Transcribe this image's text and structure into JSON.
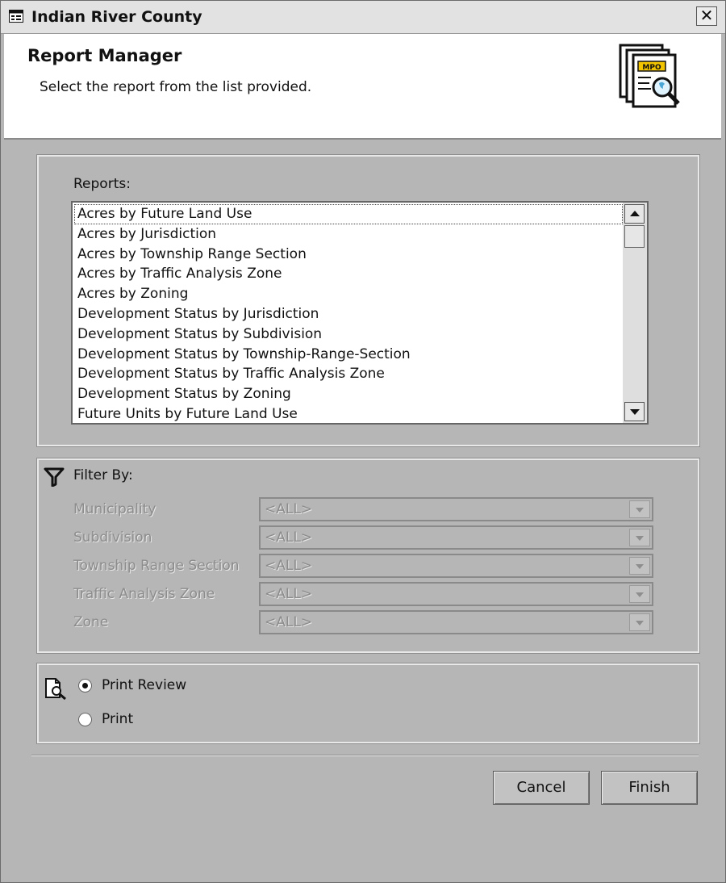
{
  "window": {
    "title": "Indian River County",
    "close_glyph": "✕"
  },
  "header": {
    "title": "Report Manager",
    "subtitle": "Select the report from the list provided.",
    "icon_text": "MPO"
  },
  "reports": {
    "label": "Reports:",
    "items": [
      "Acres by Future Land Use",
      "Acres by Jurisdiction",
      "Acres by Township Range Section",
      "Acres by Traffic Analysis Zone",
      "Acres by Zoning",
      "Development Status by Jurisdiction",
      "Development Status by Subdivision",
      "Development Status by Township-Range-Section",
      "Development Status by Traffic Analysis Zone",
      "Development Status by Zoning",
      "Future Units by Future Land Use"
    ],
    "selected_index": 0
  },
  "filter": {
    "label": "Filter By:",
    "fields": [
      {
        "label": "Municipality",
        "value": "<ALL>"
      },
      {
        "label": "Subdivision",
        "value": "<ALL>"
      },
      {
        "label": "Township Range Section",
        "value": "<ALL>"
      },
      {
        "label": "Traffic Analysis Zone",
        "value": "<ALL>"
      },
      {
        "label": "Zone",
        "value": "<ALL>"
      }
    ]
  },
  "output": {
    "options": [
      {
        "label": "Print Review",
        "checked": true
      },
      {
        "label": "Print",
        "checked": false
      }
    ]
  },
  "buttons": {
    "cancel": "Cancel",
    "finish": "Finish"
  },
  "colors": {
    "dialog_bg": "#b6b6b6",
    "header_bg": "#ffffff",
    "disabled_text": "#8c8c8c"
  }
}
